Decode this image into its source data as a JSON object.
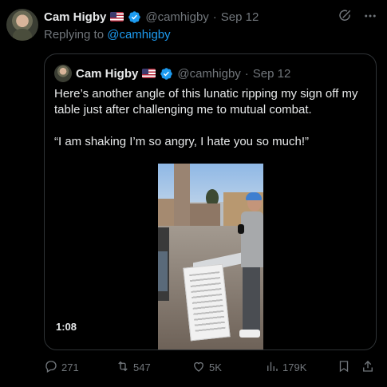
{
  "tweet": {
    "author_name": "Cam Higby",
    "handle": "@camhigby",
    "separator": "·",
    "date": "Sep 12",
    "replying_prefix": "Replying to",
    "replying_handle": "@camhigby"
  },
  "quote": {
    "author_name": "Cam Higby",
    "handle": "@camhigby",
    "separator": "·",
    "date": "Sep 12",
    "text_1": "Here’s another angle of this lunatic ripping my sign off my table just after challenging me to mutual combat.",
    "text_2": "“I am shaking I’m so angry, I hate you so much!”",
    "video_duration": "1:08"
  },
  "actions": {
    "replies": "271",
    "reposts": "547",
    "likes": "5K",
    "views": "179K"
  },
  "icons": {
    "verified": "verified-badge-icon",
    "grok": "grok-icon",
    "more": "more-icon",
    "reply": "reply-icon",
    "repost": "repost-icon",
    "like": "heart-icon",
    "views": "views-icon",
    "bookmark": "bookmark-icon",
    "share": "share-icon"
  },
  "colors": {
    "background": "#000000",
    "text": "#e7e9ea",
    "muted": "#71767b",
    "accent": "#1d9bf0",
    "border": "#2f3336"
  }
}
